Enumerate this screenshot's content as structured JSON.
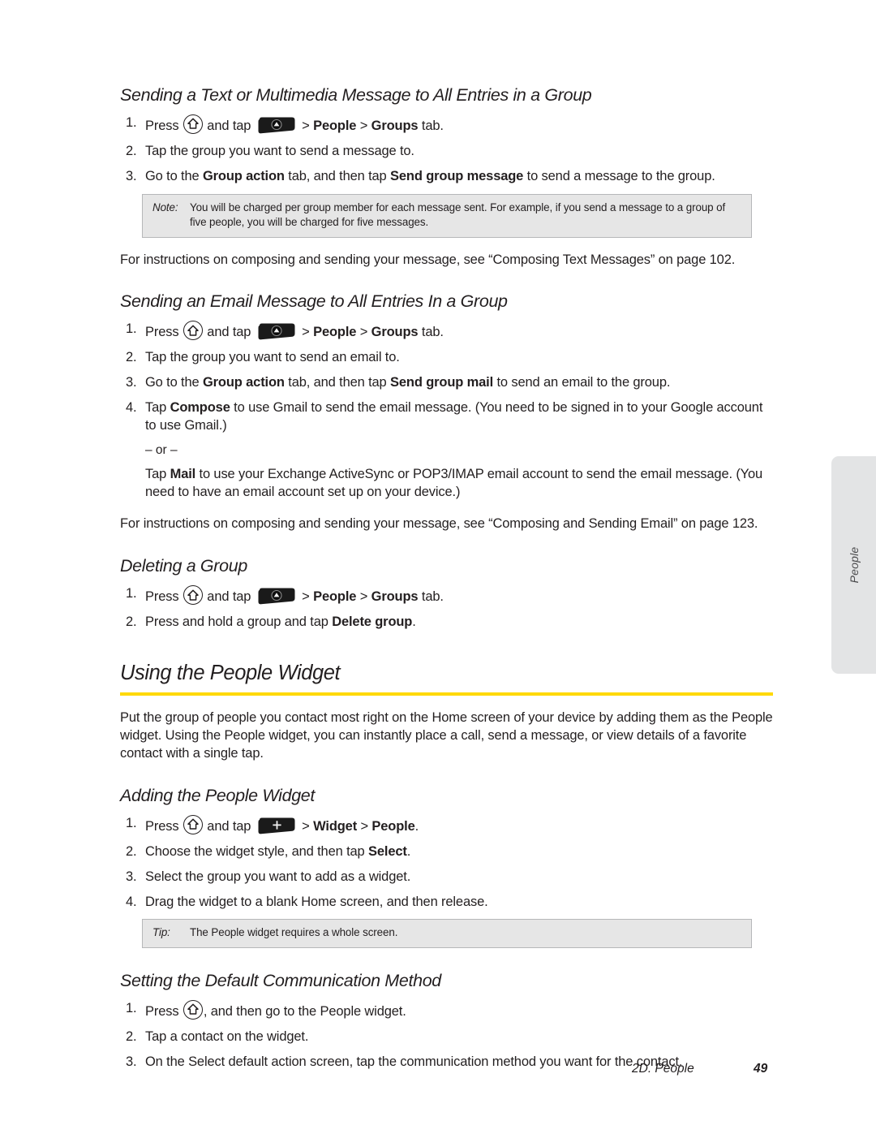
{
  "page": {
    "chapter_footer": "2D. People",
    "page_number": "49",
    "side_tab_label": "People",
    "accent_color": "#ffd900",
    "callout_bg": "#e6e6e6",
    "side_tab_bg": "#e3e4e5"
  },
  "sections": {
    "text_mms": {
      "heading": "Sending a Text or Multimedia Message to All Entries in a Group",
      "steps": [
        {
          "prefix": "Press ",
          "icon1": "home-button-icon",
          "mid": " and tap ",
          "icon2": "launcher-bar-icon",
          "suffix_plain_1": " > ",
          "bold_1": "People",
          "suffix_plain_2": " > ",
          "bold_2": "Groups",
          "suffix_plain_3": " tab."
        },
        {
          "text": "Tap the group you want to send a message to."
        },
        {
          "pre": "Go to the ",
          "bold_1": "Group action",
          "mid": " tab, and then tap ",
          "bold_2": "Send group message",
          "post": " to send a message to the group."
        }
      ],
      "note": {
        "label": "Note:",
        "text": "You will be charged per group member for each message sent. For example, if you send a message to a group of five people, you will be charged for five messages."
      },
      "closing": "For instructions on composing and sending your message, see “Composing Text Messages” on page 102."
    },
    "email": {
      "heading": "Sending an Email Message to All Entries In a Group",
      "steps": [
        {
          "prefix": "Press ",
          "icon1": "home-button-icon",
          "mid": " and tap ",
          "icon2": "launcher-bar-icon",
          "suffix_plain_1": " > ",
          "bold_1": "People",
          "suffix_plain_2": " > ",
          "bold_2": "Groups",
          "suffix_plain_3": " tab."
        },
        {
          "text": "Tap the group you want to send an email to."
        },
        {
          "pre": "Go to the ",
          "bold_1": "Group action",
          "mid": " tab, and then tap ",
          "bold_2": "Send group mail",
          "post": " to send an email to the group."
        },
        {
          "pre": "Tap ",
          "bold_1": "Compose",
          "post": " to use Gmail to send the email message. (You need to be signed in to your Google account to use Gmail.)",
          "or": "– or –",
          "alt_pre": "Tap ",
          "alt_bold": "Mail",
          "alt_post": " to use your Exchange ActiveSync or POP3/IMAP email account to send the email message. (You need to have an email account set up on your device.)"
        }
      ],
      "closing": "For instructions on composing and sending your message, see “Composing and Sending Email” on page 123."
    },
    "delete_group": {
      "heading": "Deleting a Group",
      "steps": [
        {
          "prefix": "Press ",
          "icon1": "home-button-icon",
          "mid": " and tap ",
          "icon2": "launcher-bar-icon",
          "suffix_plain_1": " > ",
          "bold_1": "People",
          "suffix_plain_2": " > ",
          "bold_2": "Groups",
          "suffix_plain_3": " tab."
        },
        {
          "pre": "Press and hold a group and tap ",
          "bold_1": "Delete group",
          "post": "."
        }
      ]
    },
    "using_widget": {
      "heading": "Using the People Widget",
      "intro": "Put the group of people you contact most right on the Home screen of your device by adding them as the People widget. Using the People widget, you can instantly place a call, send a message, or view details of a favorite contact with a single tap."
    },
    "adding_widget": {
      "heading": "Adding the People Widget",
      "steps": [
        {
          "prefix": "Press ",
          "icon1": "home-button-icon",
          "mid": " and tap ",
          "icon2": "add-widget-bar-icon",
          "suffix_plain_1": " > ",
          "bold_1": "Widget",
          "suffix_plain_2": " > ",
          "bold_2": "People",
          "suffix_plain_3": "."
        },
        {
          "pre": "Choose the widget style, and then tap ",
          "bold_1": "Select",
          "post": "."
        },
        {
          "text": "Select the group you want to add as a widget."
        },
        {
          "text": "Drag the widget to a blank Home screen, and then release."
        }
      ],
      "tip": {
        "label": "Tip:",
        "text": "The People widget requires a whole screen."
      }
    },
    "default_comm": {
      "heading": "Setting the Default Communication Method",
      "steps": [
        {
          "prefix": "Press ",
          "icon1": "home-button-icon",
          "suffix_plain_1": ", and then go to the People widget."
        },
        {
          "text": "Tap a contact on the widget."
        },
        {
          "text": "On the Select default action screen, tap the communication method you want for the contact."
        }
      ]
    }
  }
}
